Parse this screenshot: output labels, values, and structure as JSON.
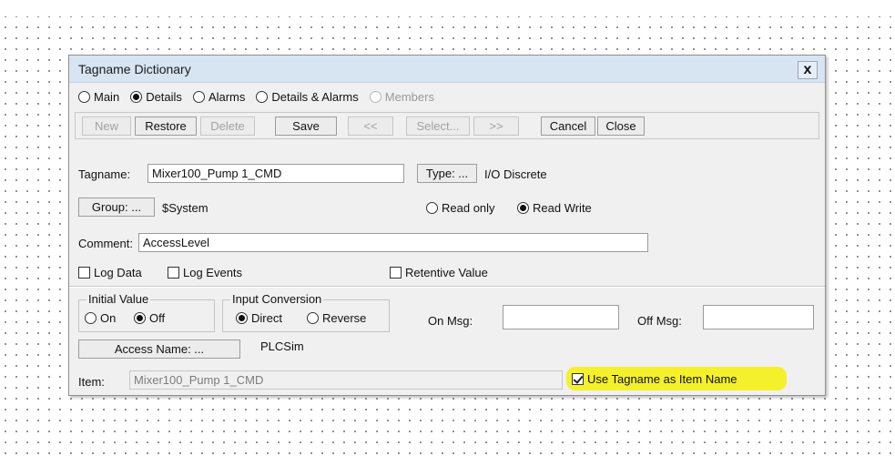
{
  "dialog": {
    "title": "Tagname Dictionary",
    "close_label": "x"
  },
  "view_options": [
    {
      "label": "Main",
      "selected": false,
      "enabled": true
    },
    {
      "label": "Details",
      "selected": true,
      "enabled": true
    },
    {
      "label": "Alarms",
      "selected": false,
      "enabled": true
    },
    {
      "label": "Details & Alarms",
      "selected": false,
      "enabled": true
    },
    {
      "label": "Members",
      "selected": false,
      "enabled": false
    }
  ],
  "toolbar": {
    "new": "New",
    "restore": "Restore",
    "delete": "Delete",
    "save": "Save",
    "prev": "<<",
    "select": "Select...",
    "next": ">>",
    "cancel": "Cancel",
    "close": "Close"
  },
  "tagname": {
    "label": "Tagname:",
    "value": "Mixer100_Pump 1_CMD",
    "type_button": "Type: ...",
    "type_value": "I/O Discrete"
  },
  "group": {
    "button": "Group: ...",
    "value": "$System"
  },
  "access_mode": {
    "read_only": "Read only",
    "read_write": "Read Write",
    "selected": "read_write"
  },
  "comment": {
    "label": "Comment:",
    "value": "AccessLevel"
  },
  "checks": {
    "log_data": {
      "label": "Log Data",
      "checked": false
    },
    "log_events": {
      "label": "Log Events",
      "checked": false
    },
    "retentive": {
      "label": "Retentive Value",
      "checked": false
    }
  },
  "initial_value": {
    "legend": "Initial Value",
    "on": "On",
    "off": "Off",
    "selected": "off"
  },
  "input_conversion": {
    "legend": "Input Conversion",
    "direct": "Direct",
    "reverse": "Reverse",
    "selected": "direct"
  },
  "messages": {
    "on_label": "On Msg:",
    "on_value": "",
    "off_label": "Off Msg:",
    "off_value": ""
  },
  "access_name": {
    "button": "Access Name: ...",
    "value": "PLCSim"
  },
  "item": {
    "label": "Item:",
    "value": "Mixer100_Pump 1_CMD"
  },
  "use_tagname": {
    "label": "Use Tagname as Item Name",
    "checked": true,
    "highlight_color": "#f5f02c"
  }
}
